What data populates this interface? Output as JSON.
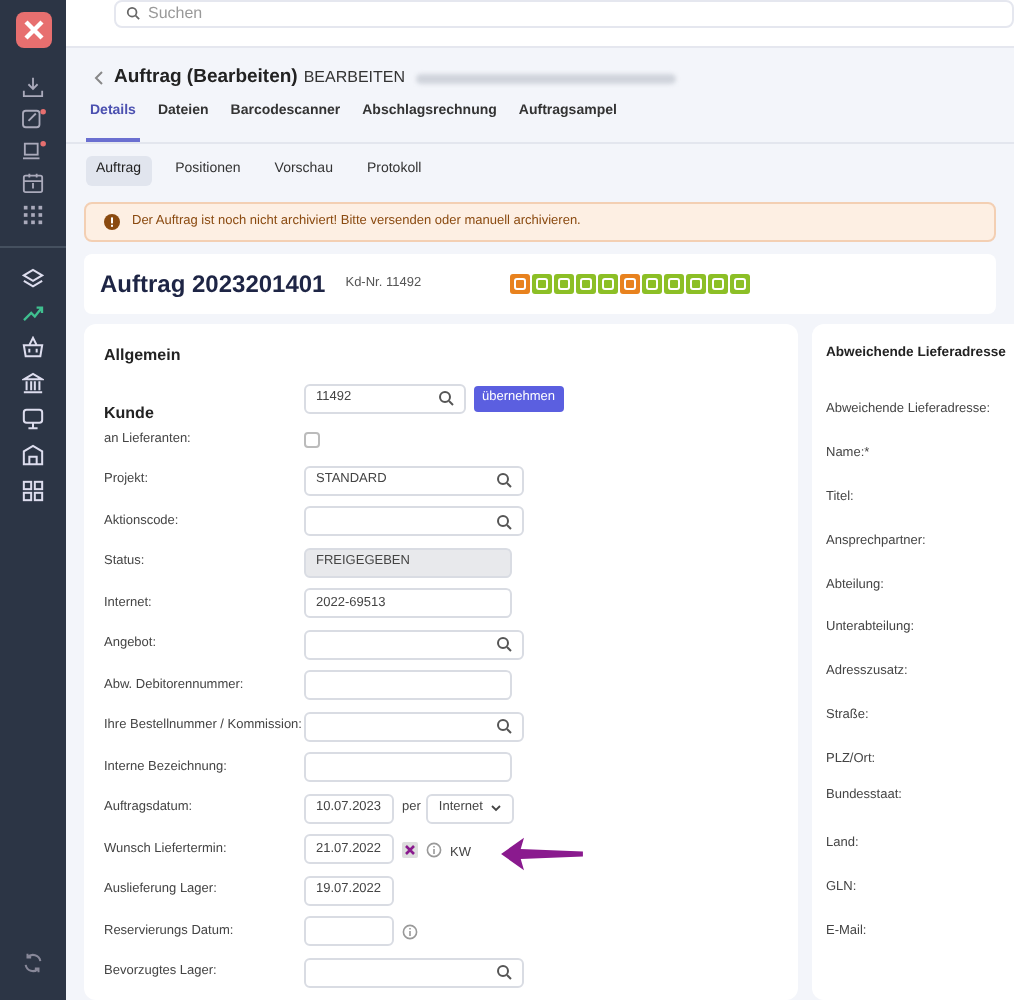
{
  "search": {
    "placeholder": "Suchen"
  },
  "header": {
    "title": "Auftrag (Bearbeiten)",
    "mode": "BEARBEITEN"
  },
  "tabs": [
    {
      "label": "Details",
      "selected": true
    },
    {
      "label": "Dateien",
      "selected": false
    },
    {
      "label": "Barcodescanner",
      "selected": false
    },
    {
      "label": "Abschlagsrechnung",
      "selected": false
    },
    {
      "label": "Auftragsampel",
      "selected": false
    }
  ],
  "subtabs": [
    {
      "label": "Auftrag",
      "selected": true
    },
    {
      "label": "Positionen",
      "selected": false
    },
    {
      "label": "Vorschau",
      "selected": false
    },
    {
      "label": "Protokoll",
      "selected": false
    }
  ],
  "alert": {
    "message": "Der Auftrag ist noch nicht archiviert! Bitte versenden oder manuell archivieren."
  },
  "order": {
    "title": "Auftrag",
    "number": "2023201401",
    "customer_no": "Kd-Nr. 11492",
    "status_icons": [
      {
        "color": "#e8821e"
      },
      {
        "color": "#8cbf26"
      },
      {
        "color": "#8cbf26"
      },
      {
        "color": "#8cbf26"
      },
      {
        "color": "#8cbf26"
      },
      {
        "color": "#e8821e"
      },
      {
        "color": "#8cbf26"
      },
      {
        "color": "#8cbf26"
      },
      {
        "color": "#8cbf26"
      },
      {
        "color": "#8cbf26"
      },
      {
        "color": "#8cbf26"
      }
    ]
  },
  "general": {
    "title": "Allgemein",
    "fields": [
      {
        "kind": "customer",
        "label": "Kunde",
        "value": "11492",
        "button": "übernehmen",
        "info": false
      },
      {
        "kind": "checkbox",
        "label": "an Lieferanten:",
        "checked": false,
        "info": false
      },
      {
        "kind": "search",
        "label": "Projekt:",
        "value": "STANDARD",
        "info": false
      },
      {
        "kind": "search",
        "label": "Aktionscode:",
        "info": false
      },
      {
        "kind": "readonly",
        "label": "Status:",
        "value": "FREIGEGEBEN",
        "info": false
      },
      {
        "kind": "text",
        "label": "Internet:",
        "value": "2022-69513",
        "info": false
      },
      {
        "kind": "search",
        "label": "Angebot:",
        "info": false
      },
      {
        "kind": "text",
        "label": "Abw. Debitorennummer:",
        "info": false
      },
      {
        "kind": "search",
        "label": "Ihre Bestellnummer / Kommission:",
        "info": false
      },
      {
        "kind": "text",
        "label": "Interne Bezeichnung:",
        "info": false
      },
      {
        "kind": "date_select",
        "label": "Auftragsdatum:",
        "value": "10.07.2023",
        "per": "per",
        "select": "Internet",
        "info": false
      },
      {
        "kind": "date_clear",
        "label": "Wunsch Liefertermin:",
        "value": "21.07.2022",
        "suffix": "KW",
        "info": true
      },
      {
        "kind": "date",
        "label": "Auslieferung Lager:",
        "value": "19.07.2022",
        "info": false
      },
      {
        "kind": "date",
        "label": "Reservierungs Datum:",
        "info": true
      },
      {
        "kind": "search",
        "label": "Bevorzugtes Lager:",
        "info": false
      }
    ]
  },
  "delivery": {
    "title": "Abweichende Lieferadresse",
    "labels": [
      "Abweichende Lieferadresse:",
      "Name:*",
      "Titel:",
      "Ansprechpartner:",
      "Abteilung:",
      "Unterabteilung:",
      "Adresszusatz:",
      "Straße:",
      "PLZ/Ort:",
      "Bundesstaat:",
      "Land:",
      "GLN:",
      "E-Mail:"
    ]
  }
}
